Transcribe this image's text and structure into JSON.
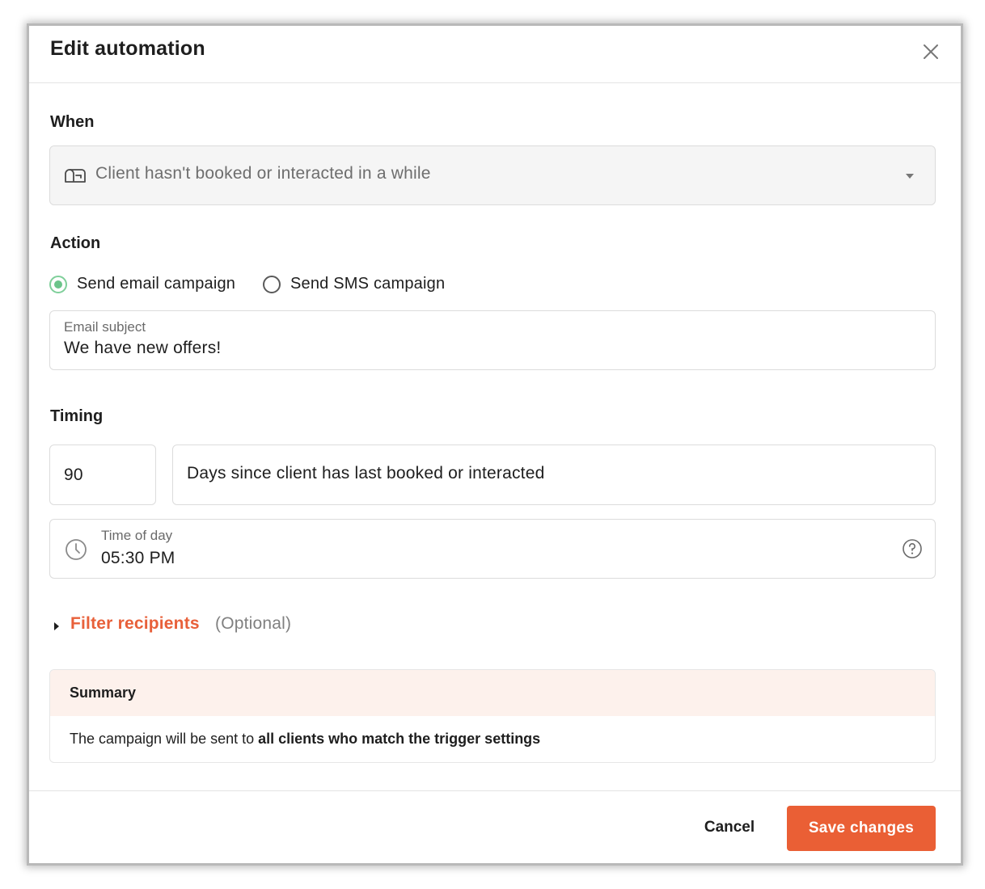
{
  "modal": {
    "title": "Edit automation",
    "close_icon": "close-icon"
  },
  "when": {
    "label": "When",
    "trigger_icon": "mailbox-icon",
    "trigger_value": "Client hasn't booked or interacted in a while",
    "dropdown_icon": "caret-down-icon"
  },
  "action": {
    "label": "Action",
    "options": [
      {
        "label": "Send email campaign",
        "checked": true
      },
      {
        "label": "Send SMS campaign",
        "checked": false
      }
    ],
    "email_subject": {
      "label": "Email subject",
      "value": "We have new offers!"
    }
  },
  "timing": {
    "label": "Timing",
    "days_value": "90",
    "days_description": "Days since client has last booked or interacted",
    "time_of_day": {
      "icon": "clock-icon",
      "label": "Time of day",
      "value": "05:30 PM",
      "help_icon": "help-circle-icon"
    }
  },
  "filter": {
    "caret_icon": "caret-right-icon",
    "link_label": "Filter recipients",
    "optional_label": "(Optional)"
  },
  "summary": {
    "title": "Summary",
    "text_prefix": "The campaign will be sent to ",
    "text_bold": "all clients who match the trigger settings"
  },
  "footer": {
    "cancel_label": "Cancel",
    "save_label": "Save changes"
  },
  "colors": {
    "accent": "#ea5f35",
    "link": "#e8603a",
    "radio_selected": "#6cc48a",
    "summary_header_bg": "#fdf1ec"
  }
}
